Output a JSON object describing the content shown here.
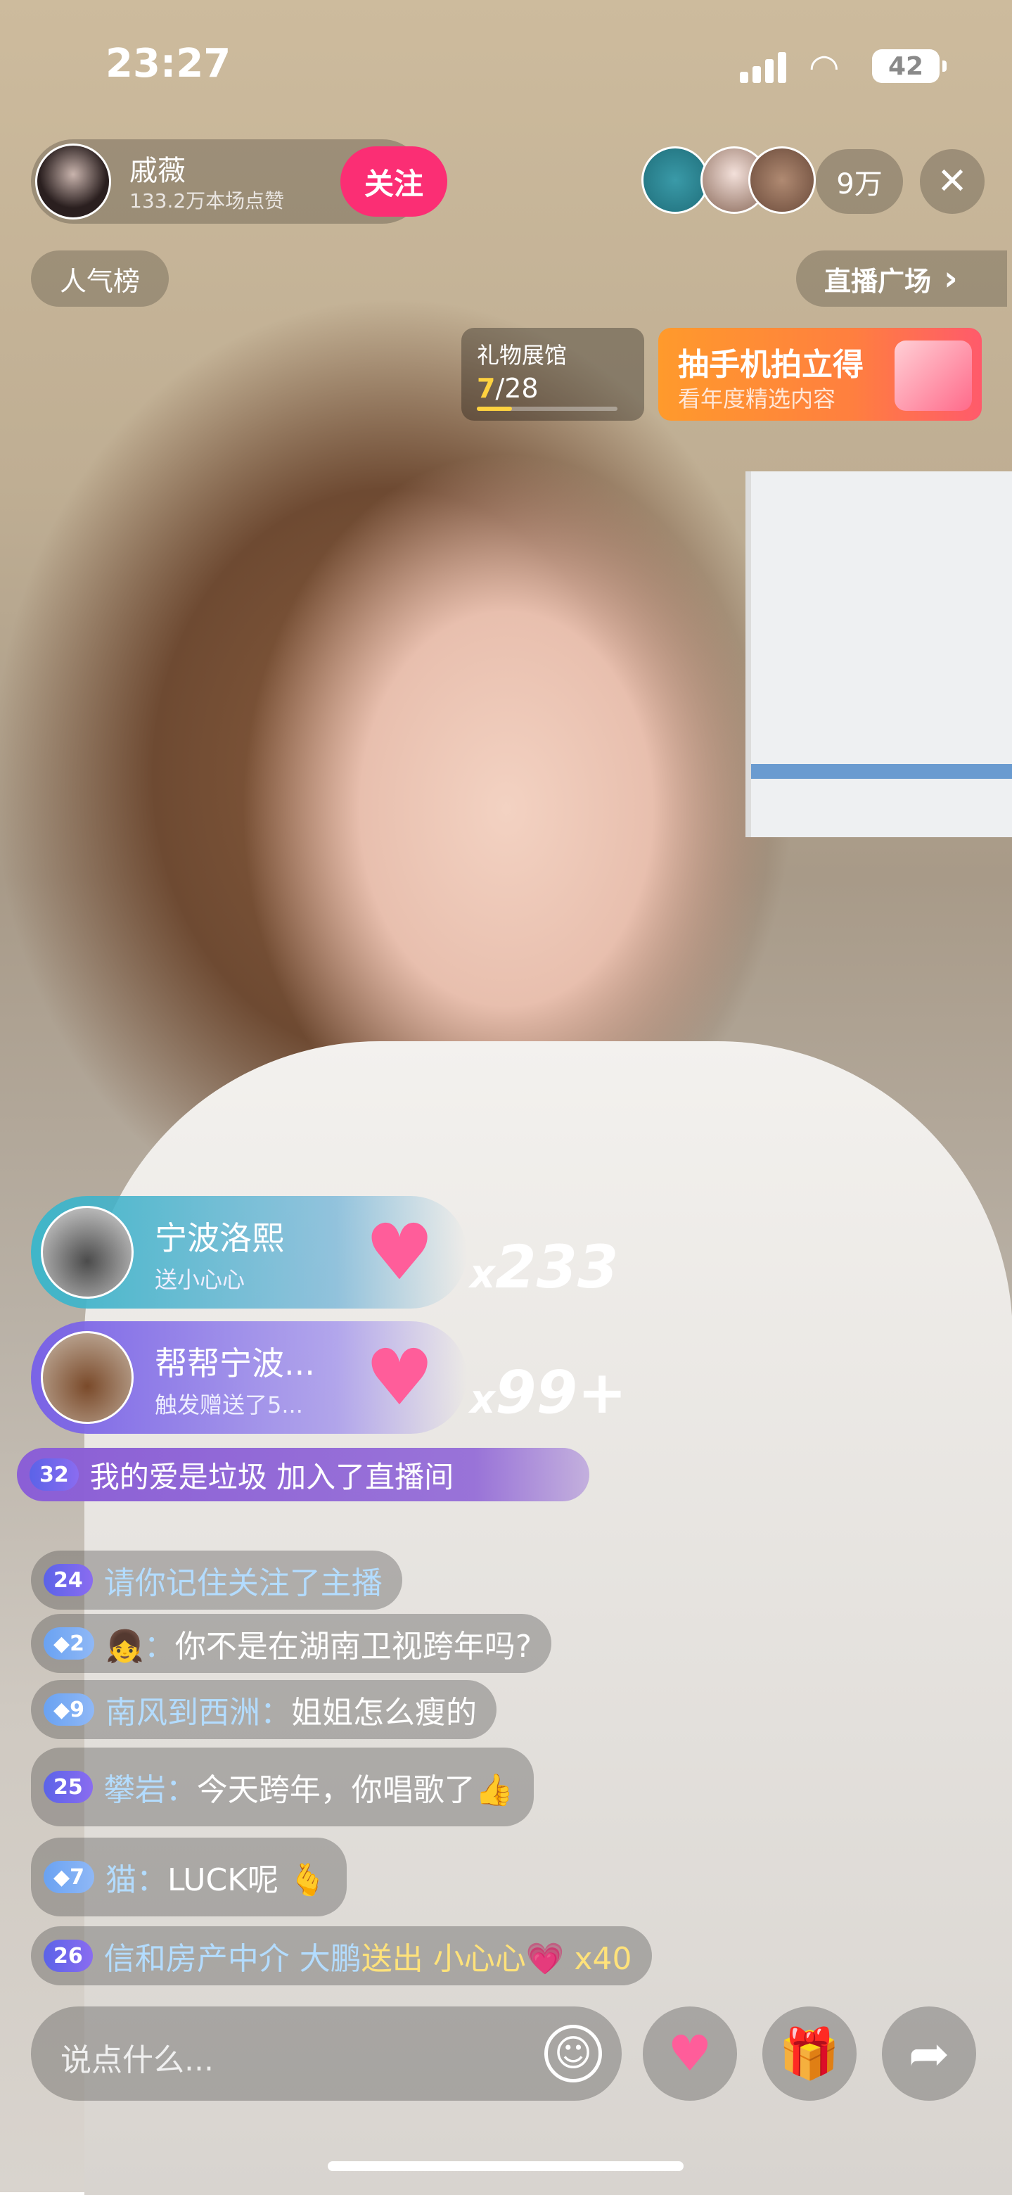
{
  "status_bar": {
    "time": "23:27",
    "battery": "42"
  },
  "host": {
    "name": "戚薇",
    "likes": "133.2万本场点赞",
    "follow_label": "关注"
  },
  "top_right": {
    "viewer_count": "9万",
    "close_icon": "close-icon"
  },
  "buttons": {
    "rank": "人气榜",
    "plaza": "直播广场",
    "plaza_chevron": "›"
  },
  "gift_hall": {
    "title": "礼物展馆",
    "progress_current": "7",
    "progress_total": "/28",
    "progress_fraction": 0.25
  },
  "promo": {
    "title": "抽手机拍立得",
    "subtitle": "看年度精选内容"
  },
  "gift_banners": [
    {
      "name": "宁波洛熙",
      "desc": "送小心心",
      "count_prefix": "x",
      "count": "233"
    },
    {
      "name": "帮帮宁波...",
      "desc": "触发赠送了5...",
      "count_prefix": "x",
      "count": "99+"
    }
  ],
  "enter_notice": {
    "level": "32",
    "text": "我的爱是垃圾 加入了直播间"
  },
  "chat": [
    {
      "level": "24",
      "user": "请你记住",
      "text": " 关注了主播",
      "badge": "purple"
    },
    {
      "level": "2",
      "user": "👧：",
      "text": "你不是在湖南卫视跨年吗?",
      "badge": "blue"
    },
    {
      "level": "9",
      "user": "南风到西洲：",
      "text": "姐姐怎么瘦的",
      "badge": "blue"
    },
    {
      "level": "25",
      "user": "攀岩：",
      "text": "今天跨年，你唱歌了👍",
      "badge": "purple"
    },
    {
      "level": "7",
      "user": "猫：",
      "text": "LUCK呢 🫰",
      "badge": "blue"
    },
    {
      "level": "26",
      "user": "信和房产中介 大鹏",
      "text": " 送出 小心心💗 x40",
      "badge": "purple"
    }
  ],
  "input": {
    "placeholder": "说点什么..."
  },
  "icons": {
    "heart": "♥",
    "gift": "🎁",
    "share": "➦",
    "emoji": "☺"
  }
}
